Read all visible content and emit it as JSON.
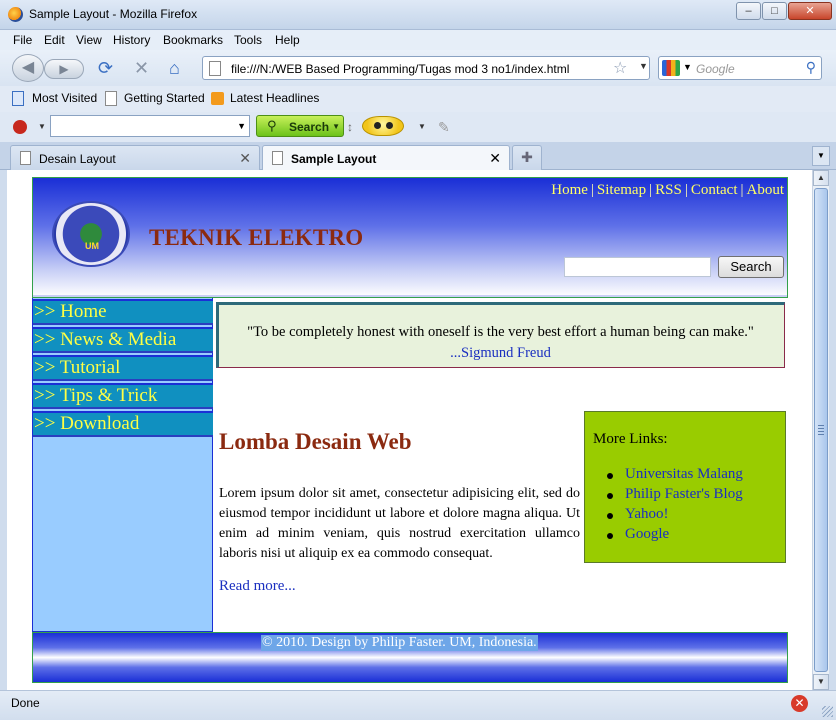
{
  "window": {
    "title": "Sample Layout - Mozilla Firefox"
  },
  "menu": [
    "File",
    "Edit",
    "View",
    "History",
    "Bookmarks",
    "Tools",
    "Help"
  ],
  "nav": {
    "url": "file:///N:/WEB Based Programming/Tugas mod 3 no1/index.html",
    "search_placeholder": "Google"
  },
  "bookmarks": [
    "Most Visited",
    "Getting Started",
    "Latest Headlines"
  ],
  "toolbar": {
    "search_label": "Search"
  },
  "tabs": [
    {
      "label": "Desain Layout",
      "active": false
    },
    {
      "label": "Sample Layout",
      "active": true
    }
  ],
  "status": {
    "text": "Done"
  },
  "page": {
    "top_links": [
      "Home",
      "Sitemap",
      "RSS",
      "Contact",
      "About"
    ],
    "logo_text": "UM",
    "site_title": "TEKNIK ELEKTRO",
    "search_button": "Search",
    "menu": [
      ">> Home",
      ">> News & Media",
      ">> Tutorial",
      ">> Tips & Trick",
      ">> Download"
    ],
    "quote": {
      "text": "\"To be completely honest with oneself is the very best effort a human being can make.\"",
      "author": "...Sigmund Freud"
    },
    "article": {
      "title": "Lomba Desain Web",
      "body": "Lorem ipsum dolor sit amet, consectetur adipisicing elit, sed do eiusmod tempor incididunt ut labore et dolore magna aliqua. Ut enim ad minim veniam, quis nostrud exercitation ullamco laboris nisi ut aliquip ex ea commodo consequat.",
      "read_more": "Read more..."
    },
    "more_links": {
      "heading": "More Links:",
      "items": [
        "Universitas Malang",
        "Philip Faster's Blog",
        "Yahoo!",
        "Google"
      ]
    },
    "footer": "© 2010. Design by Philip Faster. UM, Indonesia."
  },
  "colors": {
    "header_blue": "#1a2fd6",
    "title_red": "#8b2a10",
    "menu_yellow": "#ffff44",
    "sidebar_bg": "#99ccff",
    "links_box_bg": "#99cc00"
  }
}
